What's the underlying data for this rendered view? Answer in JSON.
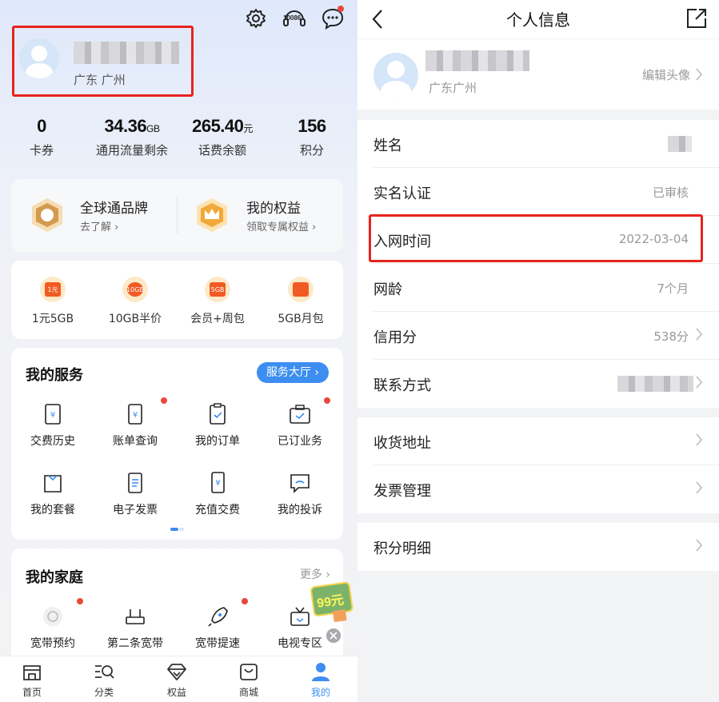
{
  "left": {
    "top_icons": [
      "gear-icon",
      "10086-headset-icon",
      "message-icon"
    ],
    "service_number": "10086",
    "profile": {
      "location": "广东 广州"
    },
    "stats": [
      {
        "value": "0",
        "unit": "",
        "label": "卡券"
      },
      {
        "value": "34.36",
        "unit": "GB",
        "label": "通用流量剩余"
      },
      {
        "value": "265.40",
        "unit": "元",
        "label": "话费余额"
      },
      {
        "value": "156",
        "unit": "",
        "label": "积分"
      }
    ],
    "brand_card": [
      {
        "title": "全球通品牌",
        "subtitle": "去了解 ›"
      },
      {
        "title": "我的权益",
        "subtitle": "领取专属权益 ›"
      }
    ],
    "promos": [
      {
        "badge": "1元",
        "label": "1元5GB"
      },
      {
        "badge": "10GB",
        "label": "10GB半价"
      },
      {
        "badge": "5GB",
        "label": "会员+周包"
      },
      {
        "badge": "",
        "label": "5GB月包"
      }
    ],
    "services": {
      "title": "我的服务",
      "hall_button": "服务大厅 ›",
      "items": [
        "交费历史",
        "账单查询",
        "我的订单",
        "已订业务",
        "我的套餐",
        "电子发票",
        "充值交费",
        "我的投诉"
      ]
    },
    "family": {
      "title": "我的家庭",
      "more": "更多 ›",
      "items": [
        "宽带预约",
        "第二条宽带",
        "宽带提速",
        "电视专区"
      ],
      "float_badge": "99元"
    },
    "tabs": [
      "首页",
      "分类",
      "权益",
      "商城",
      "我的"
    ]
  },
  "right": {
    "title": "个人信息",
    "profile": {
      "location": "广东广州",
      "edit_avatar": "编辑头像"
    },
    "rows": [
      {
        "key": "姓名",
        "value": ""
      },
      {
        "key": "实名认证",
        "value": "已审核"
      },
      {
        "key": "入网时间",
        "value": "2022-03-04"
      },
      {
        "key": "网龄",
        "value": "7个月"
      },
      {
        "key": "信用分",
        "value": "538分"
      },
      {
        "key": "联系方式",
        "value": ""
      },
      {
        "key": "收货地址",
        "value": ""
      },
      {
        "key": "发票管理",
        "value": ""
      },
      {
        "key": "积分明细",
        "value": ""
      }
    ]
  },
  "colors": {
    "accent": "#3d8ef0",
    "highlight": "#e8231d",
    "dot": "#e8483b"
  }
}
